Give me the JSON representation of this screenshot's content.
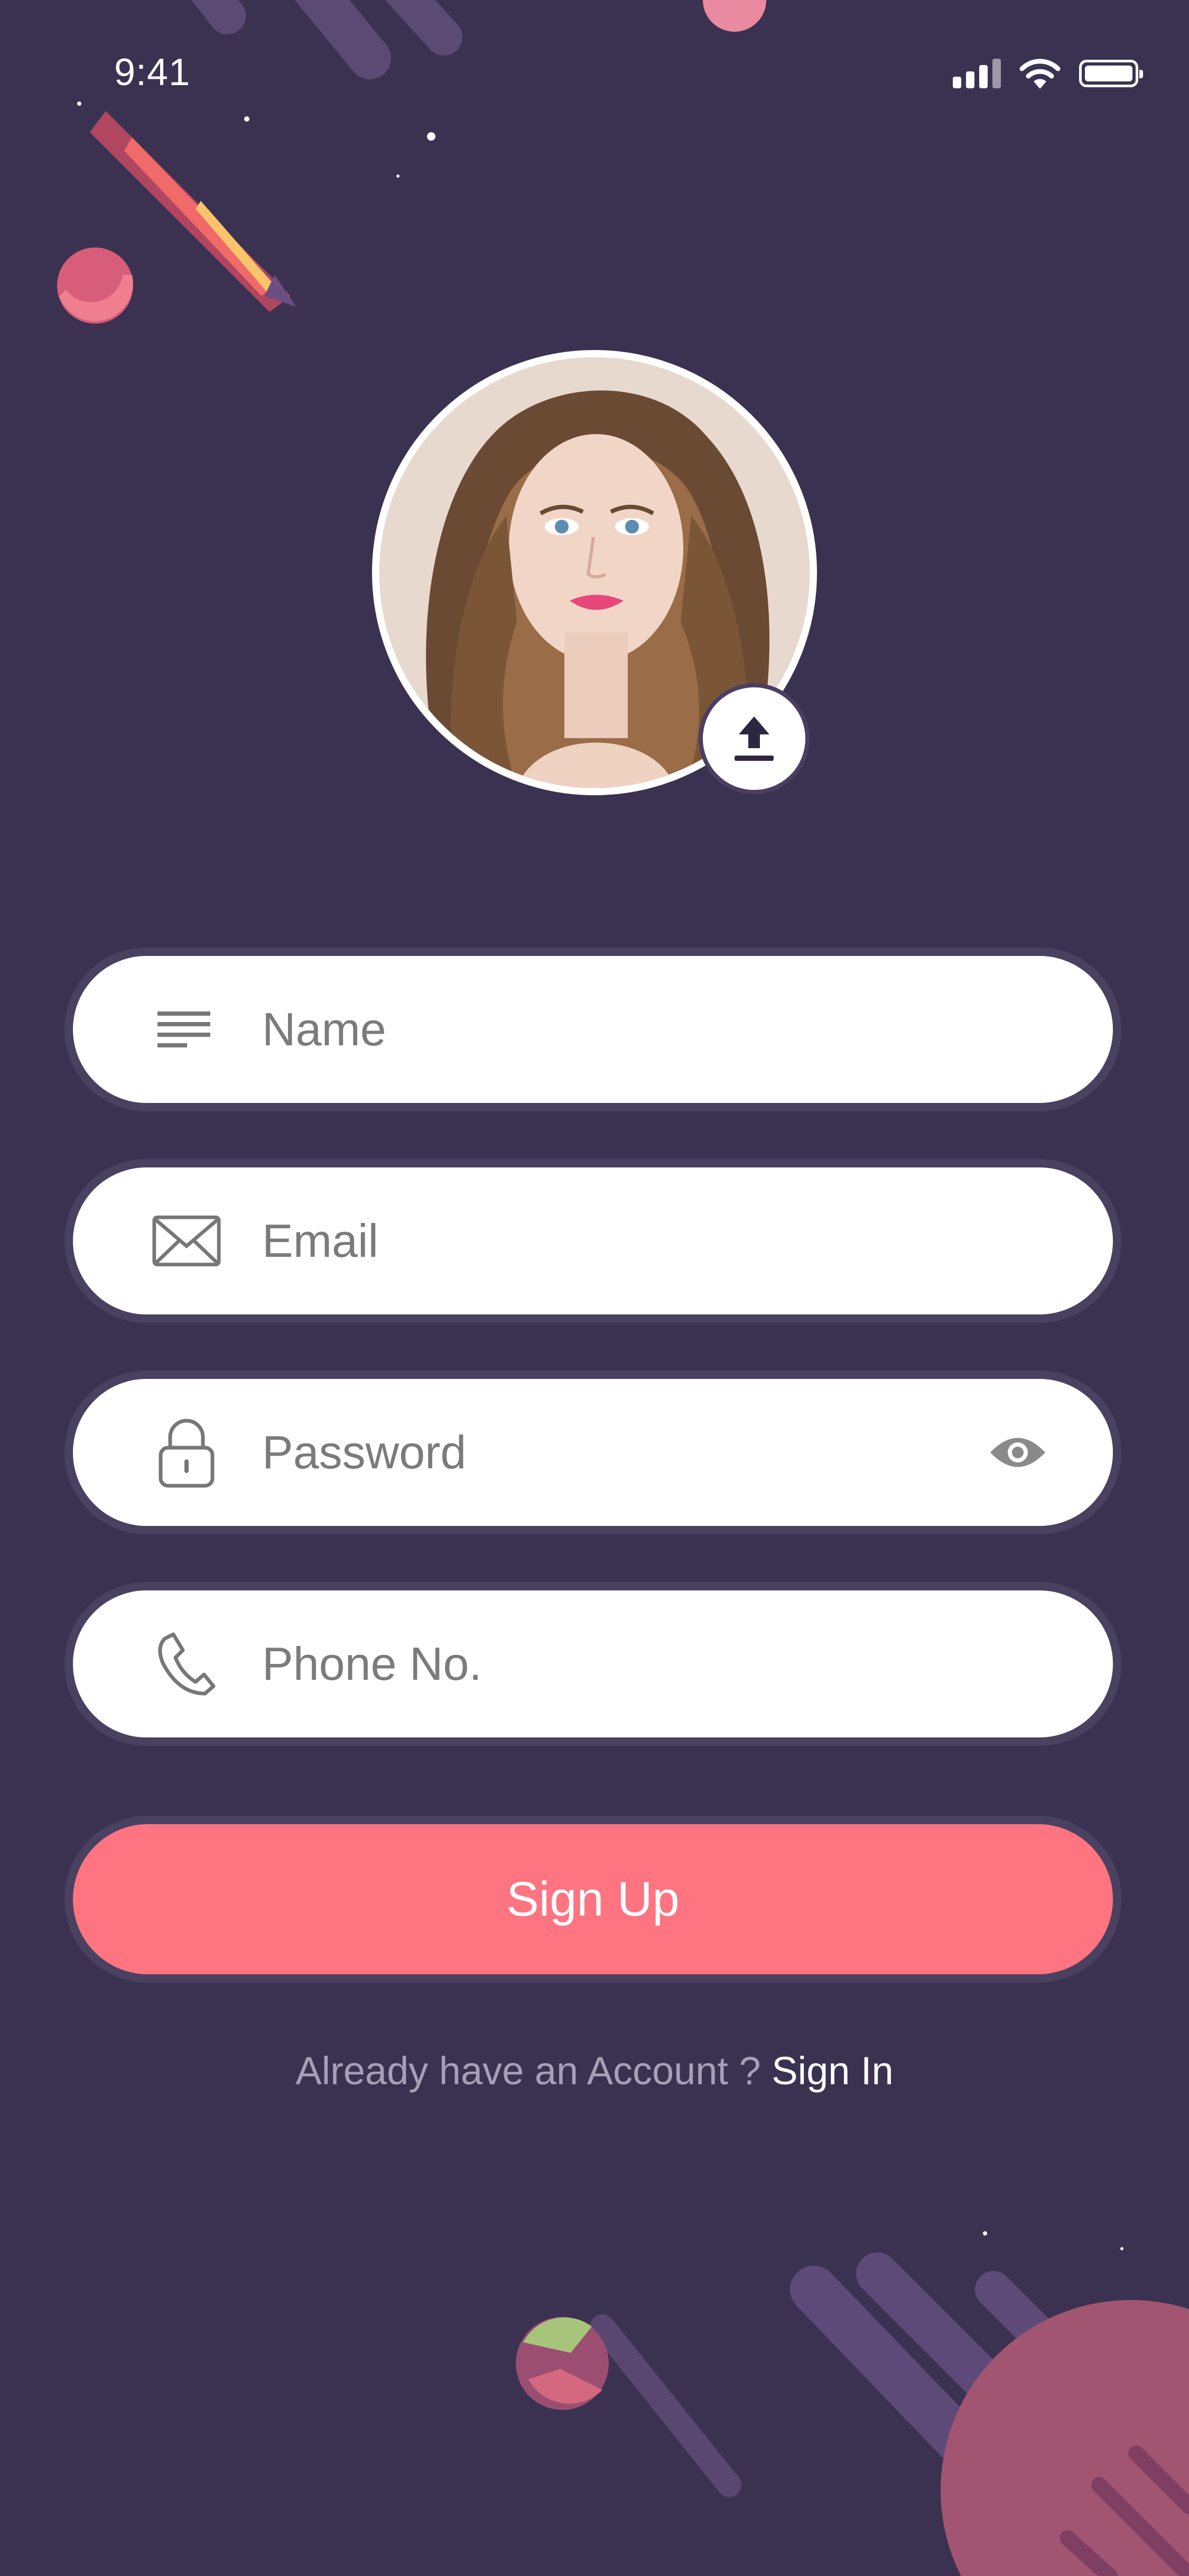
{
  "status_bar": {
    "time": "9:41"
  },
  "form": {
    "name_placeholder": "Name",
    "email_placeholder": "Email",
    "password_placeholder": "Password",
    "phone_placeholder": "Phone No."
  },
  "actions": {
    "signup_label": "Sign Up",
    "account_prompt": "Already have an Account ? ",
    "signin_label": "Sign In"
  },
  "colors": {
    "background": "#3b3251",
    "accent": "#fe7480",
    "field": "#ffffff"
  },
  "icons": {
    "upload": "upload-icon",
    "name": "text-lines-icon",
    "email": "envelope-icon",
    "password": "lock-icon",
    "show_password": "eye-icon",
    "phone": "phone-icon"
  }
}
